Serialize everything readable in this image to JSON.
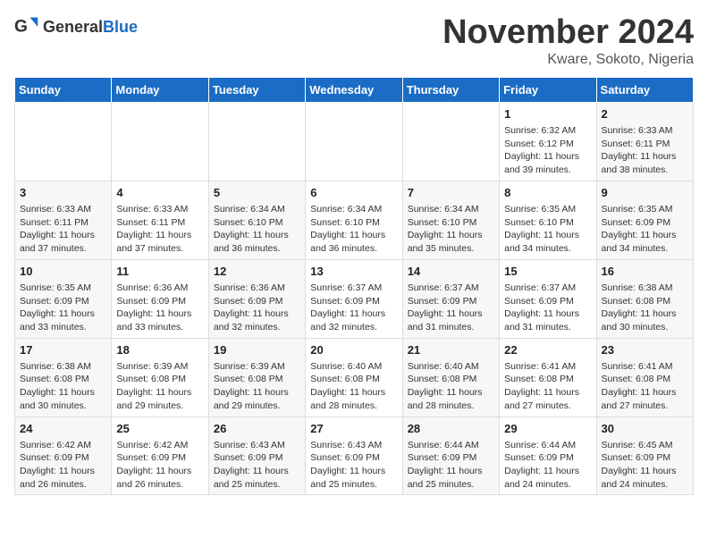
{
  "header": {
    "logo_general": "General",
    "logo_blue": "Blue",
    "month_title": "November 2024",
    "location": "Kware, Sokoto, Nigeria"
  },
  "calendar": {
    "weekdays": [
      "Sunday",
      "Monday",
      "Tuesday",
      "Wednesday",
      "Thursday",
      "Friday",
      "Saturday"
    ],
    "weeks": [
      [
        {
          "day": "",
          "content": ""
        },
        {
          "day": "",
          "content": ""
        },
        {
          "day": "",
          "content": ""
        },
        {
          "day": "",
          "content": ""
        },
        {
          "day": "",
          "content": ""
        },
        {
          "day": "1",
          "content": "Sunrise: 6:32 AM\nSunset: 6:12 PM\nDaylight: 11 hours and 39 minutes."
        },
        {
          "day": "2",
          "content": "Sunrise: 6:33 AM\nSunset: 6:11 PM\nDaylight: 11 hours and 38 minutes."
        }
      ],
      [
        {
          "day": "3",
          "content": "Sunrise: 6:33 AM\nSunset: 6:11 PM\nDaylight: 11 hours and 37 minutes."
        },
        {
          "day": "4",
          "content": "Sunrise: 6:33 AM\nSunset: 6:11 PM\nDaylight: 11 hours and 37 minutes."
        },
        {
          "day": "5",
          "content": "Sunrise: 6:34 AM\nSunset: 6:10 PM\nDaylight: 11 hours and 36 minutes."
        },
        {
          "day": "6",
          "content": "Sunrise: 6:34 AM\nSunset: 6:10 PM\nDaylight: 11 hours and 36 minutes."
        },
        {
          "day": "7",
          "content": "Sunrise: 6:34 AM\nSunset: 6:10 PM\nDaylight: 11 hours and 35 minutes."
        },
        {
          "day": "8",
          "content": "Sunrise: 6:35 AM\nSunset: 6:10 PM\nDaylight: 11 hours and 34 minutes."
        },
        {
          "day": "9",
          "content": "Sunrise: 6:35 AM\nSunset: 6:09 PM\nDaylight: 11 hours and 34 minutes."
        }
      ],
      [
        {
          "day": "10",
          "content": "Sunrise: 6:35 AM\nSunset: 6:09 PM\nDaylight: 11 hours and 33 minutes."
        },
        {
          "day": "11",
          "content": "Sunrise: 6:36 AM\nSunset: 6:09 PM\nDaylight: 11 hours and 33 minutes."
        },
        {
          "day": "12",
          "content": "Sunrise: 6:36 AM\nSunset: 6:09 PM\nDaylight: 11 hours and 32 minutes."
        },
        {
          "day": "13",
          "content": "Sunrise: 6:37 AM\nSunset: 6:09 PM\nDaylight: 11 hours and 32 minutes."
        },
        {
          "day": "14",
          "content": "Sunrise: 6:37 AM\nSunset: 6:09 PM\nDaylight: 11 hours and 31 minutes."
        },
        {
          "day": "15",
          "content": "Sunrise: 6:37 AM\nSunset: 6:09 PM\nDaylight: 11 hours and 31 minutes."
        },
        {
          "day": "16",
          "content": "Sunrise: 6:38 AM\nSunset: 6:08 PM\nDaylight: 11 hours and 30 minutes."
        }
      ],
      [
        {
          "day": "17",
          "content": "Sunrise: 6:38 AM\nSunset: 6:08 PM\nDaylight: 11 hours and 30 minutes."
        },
        {
          "day": "18",
          "content": "Sunrise: 6:39 AM\nSunset: 6:08 PM\nDaylight: 11 hours and 29 minutes."
        },
        {
          "day": "19",
          "content": "Sunrise: 6:39 AM\nSunset: 6:08 PM\nDaylight: 11 hours and 29 minutes."
        },
        {
          "day": "20",
          "content": "Sunrise: 6:40 AM\nSunset: 6:08 PM\nDaylight: 11 hours and 28 minutes."
        },
        {
          "day": "21",
          "content": "Sunrise: 6:40 AM\nSunset: 6:08 PM\nDaylight: 11 hours and 28 minutes."
        },
        {
          "day": "22",
          "content": "Sunrise: 6:41 AM\nSunset: 6:08 PM\nDaylight: 11 hours and 27 minutes."
        },
        {
          "day": "23",
          "content": "Sunrise: 6:41 AM\nSunset: 6:08 PM\nDaylight: 11 hours and 27 minutes."
        }
      ],
      [
        {
          "day": "24",
          "content": "Sunrise: 6:42 AM\nSunset: 6:09 PM\nDaylight: 11 hours and 26 minutes."
        },
        {
          "day": "25",
          "content": "Sunrise: 6:42 AM\nSunset: 6:09 PM\nDaylight: 11 hours and 26 minutes."
        },
        {
          "day": "26",
          "content": "Sunrise: 6:43 AM\nSunset: 6:09 PM\nDaylight: 11 hours and 25 minutes."
        },
        {
          "day": "27",
          "content": "Sunrise: 6:43 AM\nSunset: 6:09 PM\nDaylight: 11 hours and 25 minutes."
        },
        {
          "day": "28",
          "content": "Sunrise: 6:44 AM\nSunset: 6:09 PM\nDaylight: 11 hours and 25 minutes."
        },
        {
          "day": "29",
          "content": "Sunrise: 6:44 AM\nSunset: 6:09 PM\nDaylight: 11 hours and 24 minutes."
        },
        {
          "day": "30",
          "content": "Sunrise: 6:45 AM\nSunset: 6:09 PM\nDaylight: 11 hours and 24 minutes."
        }
      ]
    ]
  }
}
